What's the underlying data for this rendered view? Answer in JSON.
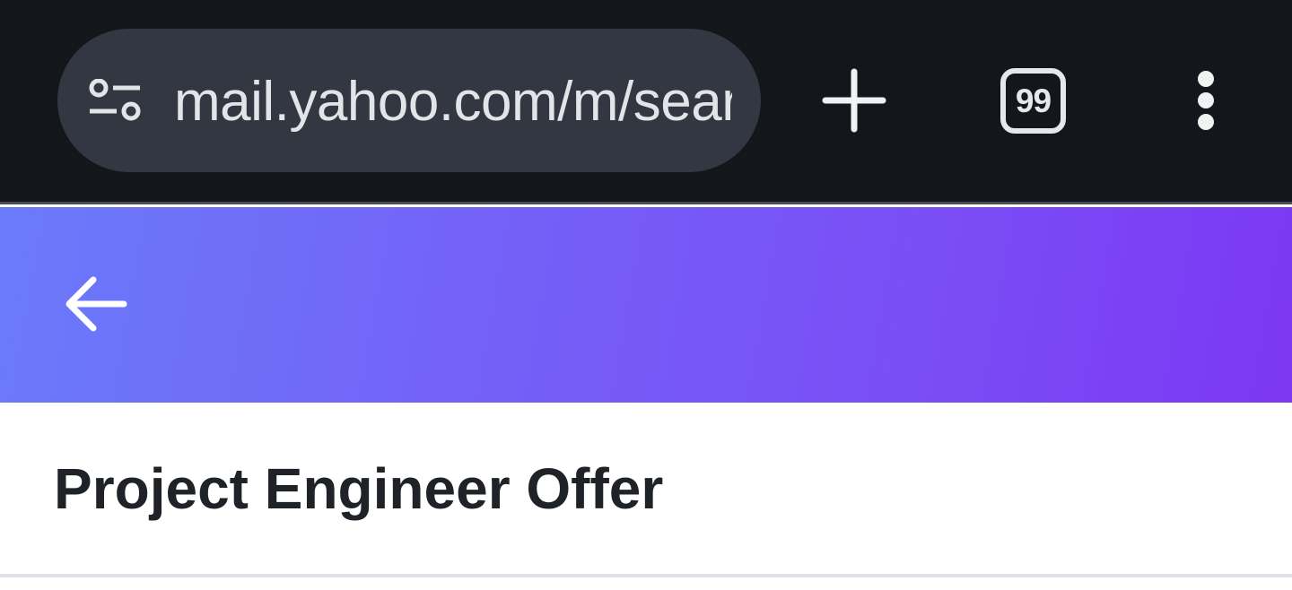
{
  "browser": {
    "url": "mail.yahoo.com/m/search",
    "tab_count": "99",
    "icons": {
      "site_settings": "site-settings-icon",
      "new_tab": "plus-icon",
      "tabs": "tab-switcher-icon",
      "menu": "more-vert-icon"
    }
  },
  "header": {
    "back_icon": "arrow-left-icon",
    "gradient": [
      "#6a7bfa",
      "#7c37f3"
    ]
  },
  "message": {
    "subject": "Project Engineer Offer"
  },
  "colors": {
    "browser_bar": "#14161b",
    "url_pill": "#333742",
    "subject_text": "#1f2328"
  }
}
